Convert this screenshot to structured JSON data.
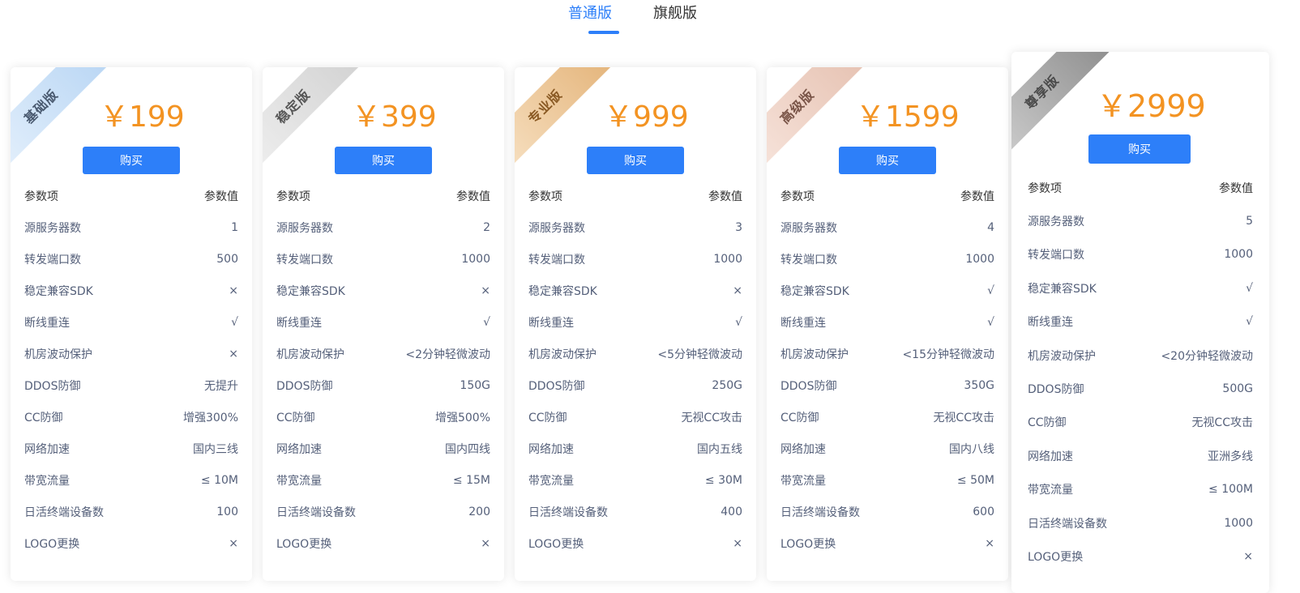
{
  "tabs": [
    {
      "label": "普通版",
      "active": true
    },
    {
      "label": "旗舰版",
      "active": false
    }
  ],
  "colors": {
    "accent": "#2d7ff9",
    "price": "#f39322",
    "ribbon_basic": "#cfe3f7",
    "ribbon_stable": "#e2e2e2",
    "ribbon_pro": "#edc89b",
    "ribbon_advanced": "#efd4c8",
    "ribbon_premium": "#a9a9a9"
  },
  "table_header": {
    "key": "参数项",
    "value": "参数值"
  },
  "buy_label": "购买",
  "plans": [
    {
      "ribbon": "基础版",
      "price": "￥199",
      "rows": [
        {
          "k": "源服务器数",
          "v": "1"
        },
        {
          "k": "转发端口数",
          "v": "500"
        },
        {
          "k": "稳定兼容SDK",
          "v": "×"
        },
        {
          "k": "断线重连",
          "v": "√"
        },
        {
          "k": "机房波动保护",
          "v": "×"
        },
        {
          "k": "DDOS防御",
          "v": "无提升"
        },
        {
          "k": "CC防御",
          "v": "增强300%"
        },
        {
          "k": "网络加速",
          "v": "国内三线"
        },
        {
          "k": "带宽流量",
          "v": "≤ 10M"
        },
        {
          "k": "日活终端设备数",
          "v": "100"
        },
        {
          "k": "LOGO更换",
          "v": "×"
        }
      ]
    },
    {
      "ribbon": "稳定版",
      "price": "￥399",
      "rows": [
        {
          "k": "源服务器数",
          "v": "2"
        },
        {
          "k": "转发端口数",
          "v": "1000"
        },
        {
          "k": "稳定兼容SDK",
          "v": "×"
        },
        {
          "k": "断线重连",
          "v": "√"
        },
        {
          "k": "机房波动保护",
          "v": "<2分钟轻微波动"
        },
        {
          "k": "DDOS防御",
          "v": "150G"
        },
        {
          "k": "CC防御",
          "v": "增强500%"
        },
        {
          "k": "网络加速",
          "v": "国内四线"
        },
        {
          "k": "带宽流量",
          "v": "≤ 15M"
        },
        {
          "k": "日活终端设备数",
          "v": "200"
        },
        {
          "k": "LOGO更换",
          "v": "×"
        }
      ]
    },
    {
      "ribbon": "专业版",
      "price": "￥999",
      "rows": [
        {
          "k": "源服务器数",
          "v": "3"
        },
        {
          "k": "转发端口数",
          "v": "1000"
        },
        {
          "k": "稳定兼容SDK",
          "v": "×"
        },
        {
          "k": "断线重连",
          "v": "√"
        },
        {
          "k": "机房波动保护",
          "v": "<5分钟轻微波动"
        },
        {
          "k": "DDOS防御",
          "v": "250G"
        },
        {
          "k": "CC防御",
          "v": "无视CC攻击"
        },
        {
          "k": "网络加速",
          "v": "国内五线"
        },
        {
          "k": "带宽流量",
          "v": "≤ 30M"
        },
        {
          "k": "日活终端设备数",
          "v": "400"
        },
        {
          "k": "LOGO更换",
          "v": "×"
        }
      ]
    },
    {
      "ribbon": "高级版",
      "price": "￥1599",
      "rows": [
        {
          "k": "源服务器数",
          "v": "4"
        },
        {
          "k": "转发端口数",
          "v": "1000"
        },
        {
          "k": "稳定兼容SDK",
          "v": "√"
        },
        {
          "k": "断线重连",
          "v": "√"
        },
        {
          "k": "机房波动保护",
          "v": "<15分钟轻微波动"
        },
        {
          "k": "DDOS防御",
          "v": "350G"
        },
        {
          "k": "CC防御",
          "v": "无视CC攻击"
        },
        {
          "k": "网络加速",
          "v": "国内八线"
        },
        {
          "k": "带宽流量",
          "v": "≤ 50M"
        },
        {
          "k": "日活终端设备数",
          "v": "600"
        },
        {
          "k": "LOGO更换",
          "v": "×"
        }
      ]
    },
    {
      "ribbon": "尊享版",
      "price": "￥2999",
      "rows": [
        {
          "k": "源服务器数",
          "v": "5"
        },
        {
          "k": "转发端口数",
          "v": "1000"
        },
        {
          "k": "稳定兼容SDK",
          "v": "√"
        },
        {
          "k": "断线重连",
          "v": "√"
        },
        {
          "k": "机房波动保护",
          "v": "<20分钟轻微波动"
        },
        {
          "k": "DDOS防御",
          "v": "500G"
        },
        {
          "k": "CC防御",
          "v": "无视CC攻击"
        },
        {
          "k": "网络加速",
          "v": "亚洲多线"
        },
        {
          "k": "带宽流量",
          "v": "≤ 100M"
        },
        {
          "k": "日活终端设备数",
          "v": "1000"
        },
        {
          "k": "LOGO更换",
          "v": "×"
        }
      ]
    }
  ]
}
